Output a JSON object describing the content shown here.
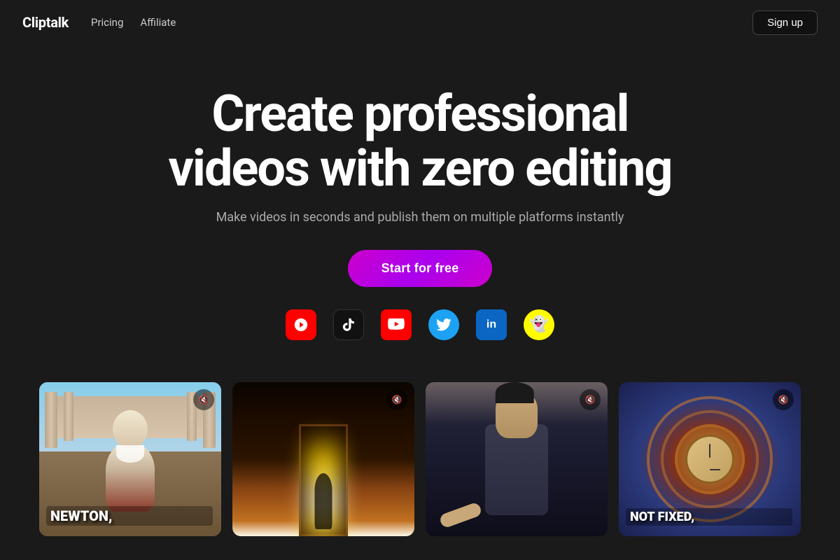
{
  "navbar": {
    "logo": "Cliptalk",
    "links": [
      {
        "label": "Pricing",
        "id": "pricing"
      },
      {
        "label": "Affiliate",
        "id": "affiliate"
      }
    ],
    "signup_label": "Sign up"
  },
  "hero": {
    "title_line1": "Create professional",
    "title_line2": "videos with zero editing",
    "subtitle": "Make videos in seconds and publish them on multiple platforms instantly",
    "cta_label": "Start for free"
  },
  "platforms": [
    {
      "id": "youtube-shorts",
      "label": "YouTube Shorts",
      "symbol": "▶"
    },
    {
      "id": "tiktok",
      "label": "TikTok",
      "symbol": "♪"
    },
    {
      "id": "youtube",
      "label": "YouTube",
      "symbol": "▶"
    },
    {
      "id": "twitter",
      "label": "Twitter",
      "symbol": "🐦"
    },
    {
      "id": "linkedin",
      "label": "LinkedIn",
      "symbol": "in"
    },
    {
      "id": "snapchat",
      "label": "Snapchat",
      "symbol": "👻"
    }
  ],
  "video_cards": [
    {
      "id": "newton",
      "caption": "NEWTON,",
      "mute": "🔇"
    },
    {
      "id": "door",
      "caption": "",
      "mute": "🔇"
    },
    {
      "id": "man",
      "caption": "",
      "mute": "🔇"
    },
    {
      "id": "swirl",
      "caption": "NOT FIXED,",
      "mute": "🔇"
    }
  ]
}
